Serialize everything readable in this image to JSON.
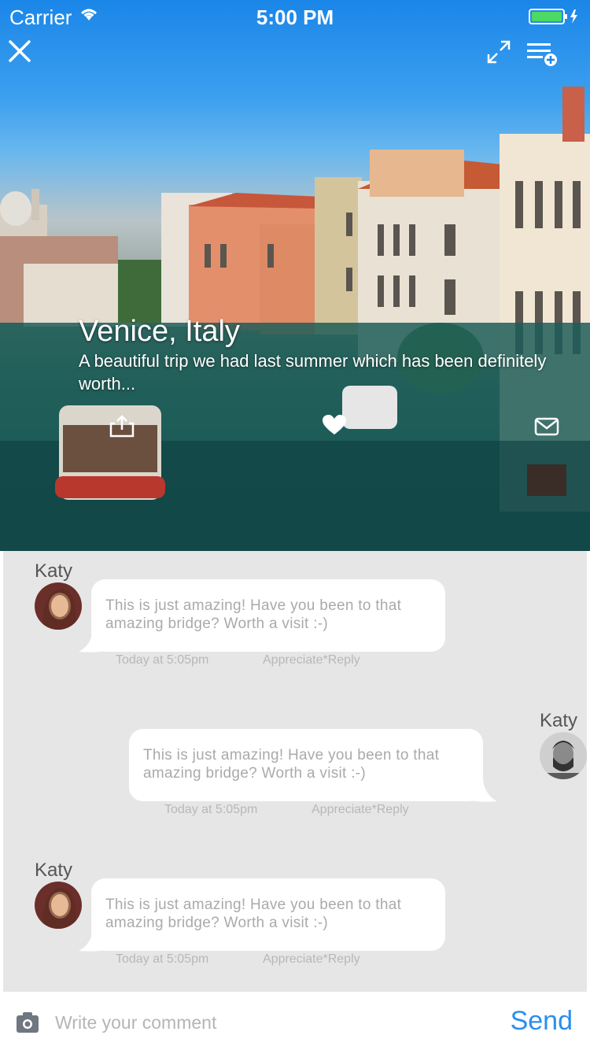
{
  "status_bar": {
    "carrier": "Carrier",
    "time": "5:00 PM"
  },
  "post": {
    "title": "Venice, Italy",
    "description": "A beautiful trip we had last summer which has been definitely worth..."
  },
  "comments": [
    {
      "name": "Katy",
      "text": "This is just amazing! Have you been to that amazing bridge? Worth a visit :-)",
      "time": "Today at 5:05pm",
      "actions": "Appreciate*Reply"
    },
    {
      "name": "Katy",
      "text": "This is just amazing! Have you been to that amazing bridge? Worth a visit :-)",
      "time": "Today at 5:05pm",
      "actions": "Appreciate*Reply"
    },
    {
      "name": "Katy",
      "text": "This is just amazing! Have you been to that amazing bridge? Worth a visit :-)",
      "time": "Today at 5:05pm",
      "actions": "Appreciate*Reply"
    }
  ],
  "composer": {
    "placeholder": "Write your comment",
    "send_label": "Send"
  },
  "icons": [
    "close-icon",
    "expand-icon",
    "add-to-list-icon",
    "share-icon",
    "heart-icon",
    "mail-icon",
    "camera-icon",
    "wifi-icon",
    "battery-icon"
  ],
  "colors": {
    "accent": "#2a8ef0",
    "battery": "#4cd964",
    "comments_bg": "#e6e6e6"
  }
}
